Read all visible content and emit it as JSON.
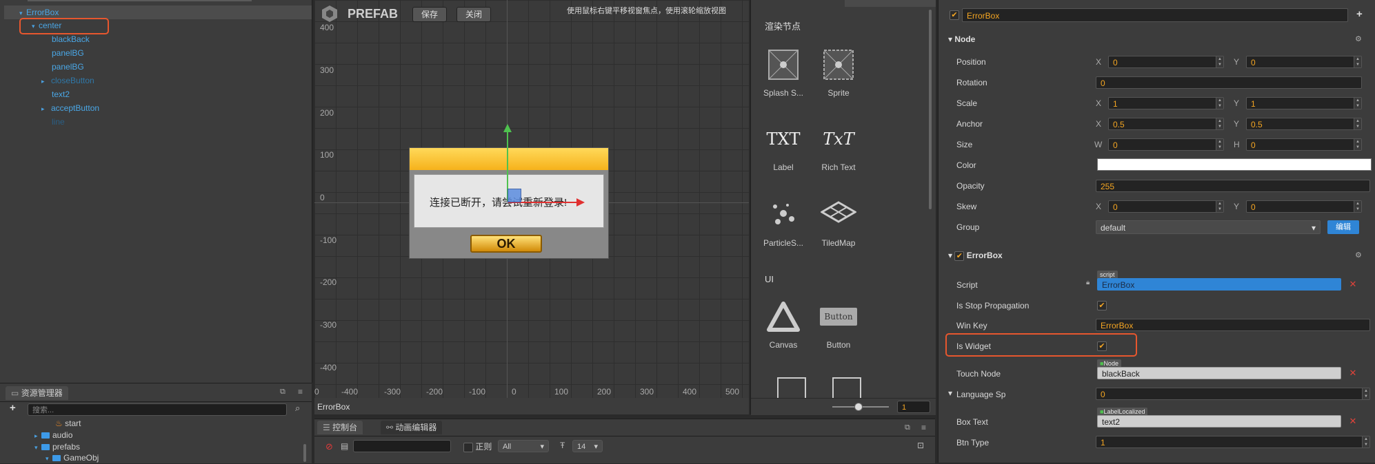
{
  "hierarchy": {
    "items": [
      {
        "label": "ErrorBox",
        "arrow": "▾"
      },
      {
        "label": "center",
        "arrow": "▾"
      },
      {
        "label": "blackBack",
        "arrow": ""
      },
      {
        "label": "panelBG",
        "arrow": ""
      },
      {
        "label": "panelBG",
        "arrow": ""
      },
      {
        "label": "closeButton",
        "arrow": "▸"
      },
      {
        "label": "text2",
        "arrow": ""
      },
      {
        "label": "acceptButton",
        "arrow": "▸"
      },
      {
        "label": "line",
        "arrow": ""
      }
    ]
  },
  "assets": {
    "tab_label": "资源管理器",
    "add_label": "+",
    "search_placeholder": "搜索...",
    "tree": [
      {
        "label": "start",
        "arrow": ""
      },
      {
        "label": "audio",
        "arrow": "▸"
      },
      {
        "label": "prefabs",
        "arrow": "▾"
      },
      {
        "label": "GameObj",
        "arrow": "▾"
      }
    ]
  },
  "scene": {
    "mode_label": "PREFAB",
    "save_button": "保存",
    "close_button": "关闭",
    "hint": "使用鼠标右键平移视窗焦点，使用滚轮缩放视图",
    "y_ticks": [
      "400",
      "300",
      "200",
      "100",
      "0",
      "-100",
      "-200",
      "-300",
      "-400"
    ],
    "x_ticks": [
      "0",
      "-400",
      "-300",
      "-200",
      "-100",
      "0",
      "100",
      "200",
      "300",
      "400",
      "500"
    ],
    "dialog_text": "连接已断开，请尝试重新登录!",
    "ok_text": "OK",
    "footer_label": "ErrorBox"
  },
  "library": {
    "render_title": "渲染节点",
    "ui_title": "UI",
    "items": [
      {
        "label": "Splash S..."
      },
      {
        "label": "Sprite"
      },
      {
        "label": "Label"
      },
      {
        "label": "Rich Text"
      },
      {
        "label": "ParticleS..."
      },
      {
        "label": "TiledMap"
      },
      {
        "label": "Canvas"
      },
      {
        "label": "Button"
      }
    ],
    "label_icon_text": "TXT",
    "richtext_icon_text": "TxT",
    "button_icon_text": "Button",
    "zoom_value": "1"
  },
  "console": {
    "tab_console": "控制台",
    "tab_anim": "动画编辑器",
    "regex_label": "正则",
    "level_value": "All",
    "font_size_value": "14"
  },
  "inspector": {
    "node_name": "ErrorBox",
    "add_label": "+",
    "node_section": "Node",
    "position": {
      "label": "Position",
      "x": "0",
      "y": "0"
    },
    "rotation": {
      "label": "Rotation",
      "value": "0"
    },
    "scale": {
      "label": "Scale",
      "x": "1",
      "y": "1"
    },
    "anchor": {
      "label": "Anchor",
      "x": "0.5",
      "y": "0.5"
    },
    "size": {
      "label": "Size",
      "w": "0",
      "h": "0"
    },
    "color": {
      "label": "Color",
      "value": "#ffffff"
    },
    "opacity": {
      "label": "Opacity",
      "value": "255"
    },
    "skew": {
      "label": "Skew",
      "x": "0",
      "y": "0"
    },
    "group": {
      "label": "Group",
      "value": "default",
      "edit_label": "编辑"
    },
    "component_section": "ErrorBox",
    "script": {
      "label": "Script",
      "tag": "script",
      "value": "ErrorBox"
    },
    "stop_propagation": {
      "label": "Is Stop Propagation",
      "checked": "✔"
    },
    "win_key": {
      "label": "Win Key",
      "value": "ErrorBox"
    },
    "is_widget": {
      "label": "Is Widget",
      "checked": "✔"
    },
    "touch_node": {
      "label": "Touch Node",
      "tag": "Node",
      "value": "blackBack"
    },
    "language_sp": {
      "label": "Language Sp",
      "value": "0"
    },
    "box_text": {
      "label": "Box Text",
      "tag": "LabelLocalized",
      "value": "text2"
    },
    "btn_type": {
      "label": "Btn Type",
      "value": "1"
    },
    "axis_x": "X",
    "axis_y": "Y",
    "axis_w": "W",
    "axis_h": "H"
  },
  "colors": {
    "accent": "#4aa7e6",
    "highlight": "#e8572e",
    "value": "#f5a623"
  }
}
